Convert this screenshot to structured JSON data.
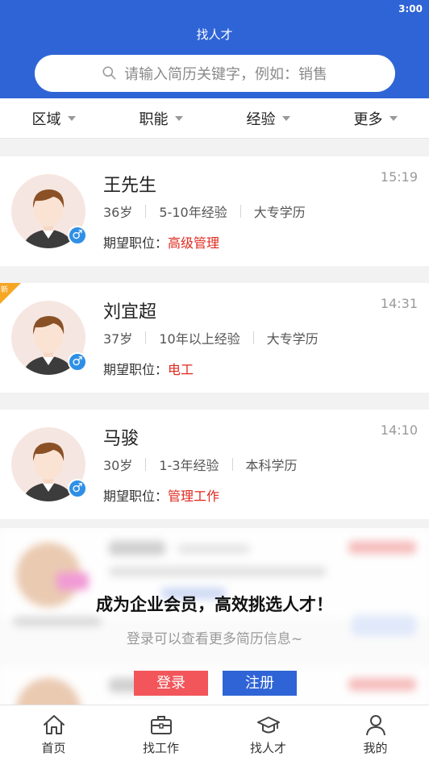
{
  "status_bar": {
    "time": "3:00"
  },
  "header": {
    "title": "找人才"
  },
  "search": {
    "placeholder": "请输入简历关键字，例如：销售"
  },
  "filters": [
    {
      "label": "区域"
    },
    {
      "label": "职能"
    },
    {
      "label": "经验"
    },
    {
      "label": "更多"
    }
  ],
  "expect_label": "期望职位：",
  "candidates": [
    {
      "name": "王先生",
      "time": "15:19",
      "age": "36岁",
      "experience": "5-10年经验",
      "education": "大专学历",
      "position": "高级管理",
      "gender": "♂",
      "is_new": false
    },
    {
      "name": "刘宜超",
      "time": "14:31",
      "age": "37岁",
      "experience": "10年以上经验",
      "education": "大专学历",
      "position": "电工",
      "gender": "♂",
      "is_new": true,
      "badge": "新"
    },
    {
      "name": "马骏",
      "time": "14:10",
      "age": "30岁",
      "experience": "1-3年经验",
      "education": "本科学历",
      "position": "管理工作",
      "gender": "♂",
      "is_new": false
    }
  ],
  "promo": {
    "title": "成为企业会员，高效挑选人才！",
    "subtitle": "登录可以查看更多简历信息~",
    "login_label": "登录",
    "register_label": "注册"
  },
  "tabbar": [
    {
      "label": "首页",
      "icon": "home-icon"
    },
    {
      "label": "找工作",
      "icon": "briefcase-icon"
    },
    {
      "label": "找人才",
      "icon": "graduation-cap-icon"
    },
    {
      "label": "我的",
      "icon": "user-icon"
    }
  ],
  "colors": {
    "primary": "#2f64d6",
    "accent_red": "#e0281e",
    "login_red": "#f2555a",
    "new_badge": "#f5a623"
  }
}
